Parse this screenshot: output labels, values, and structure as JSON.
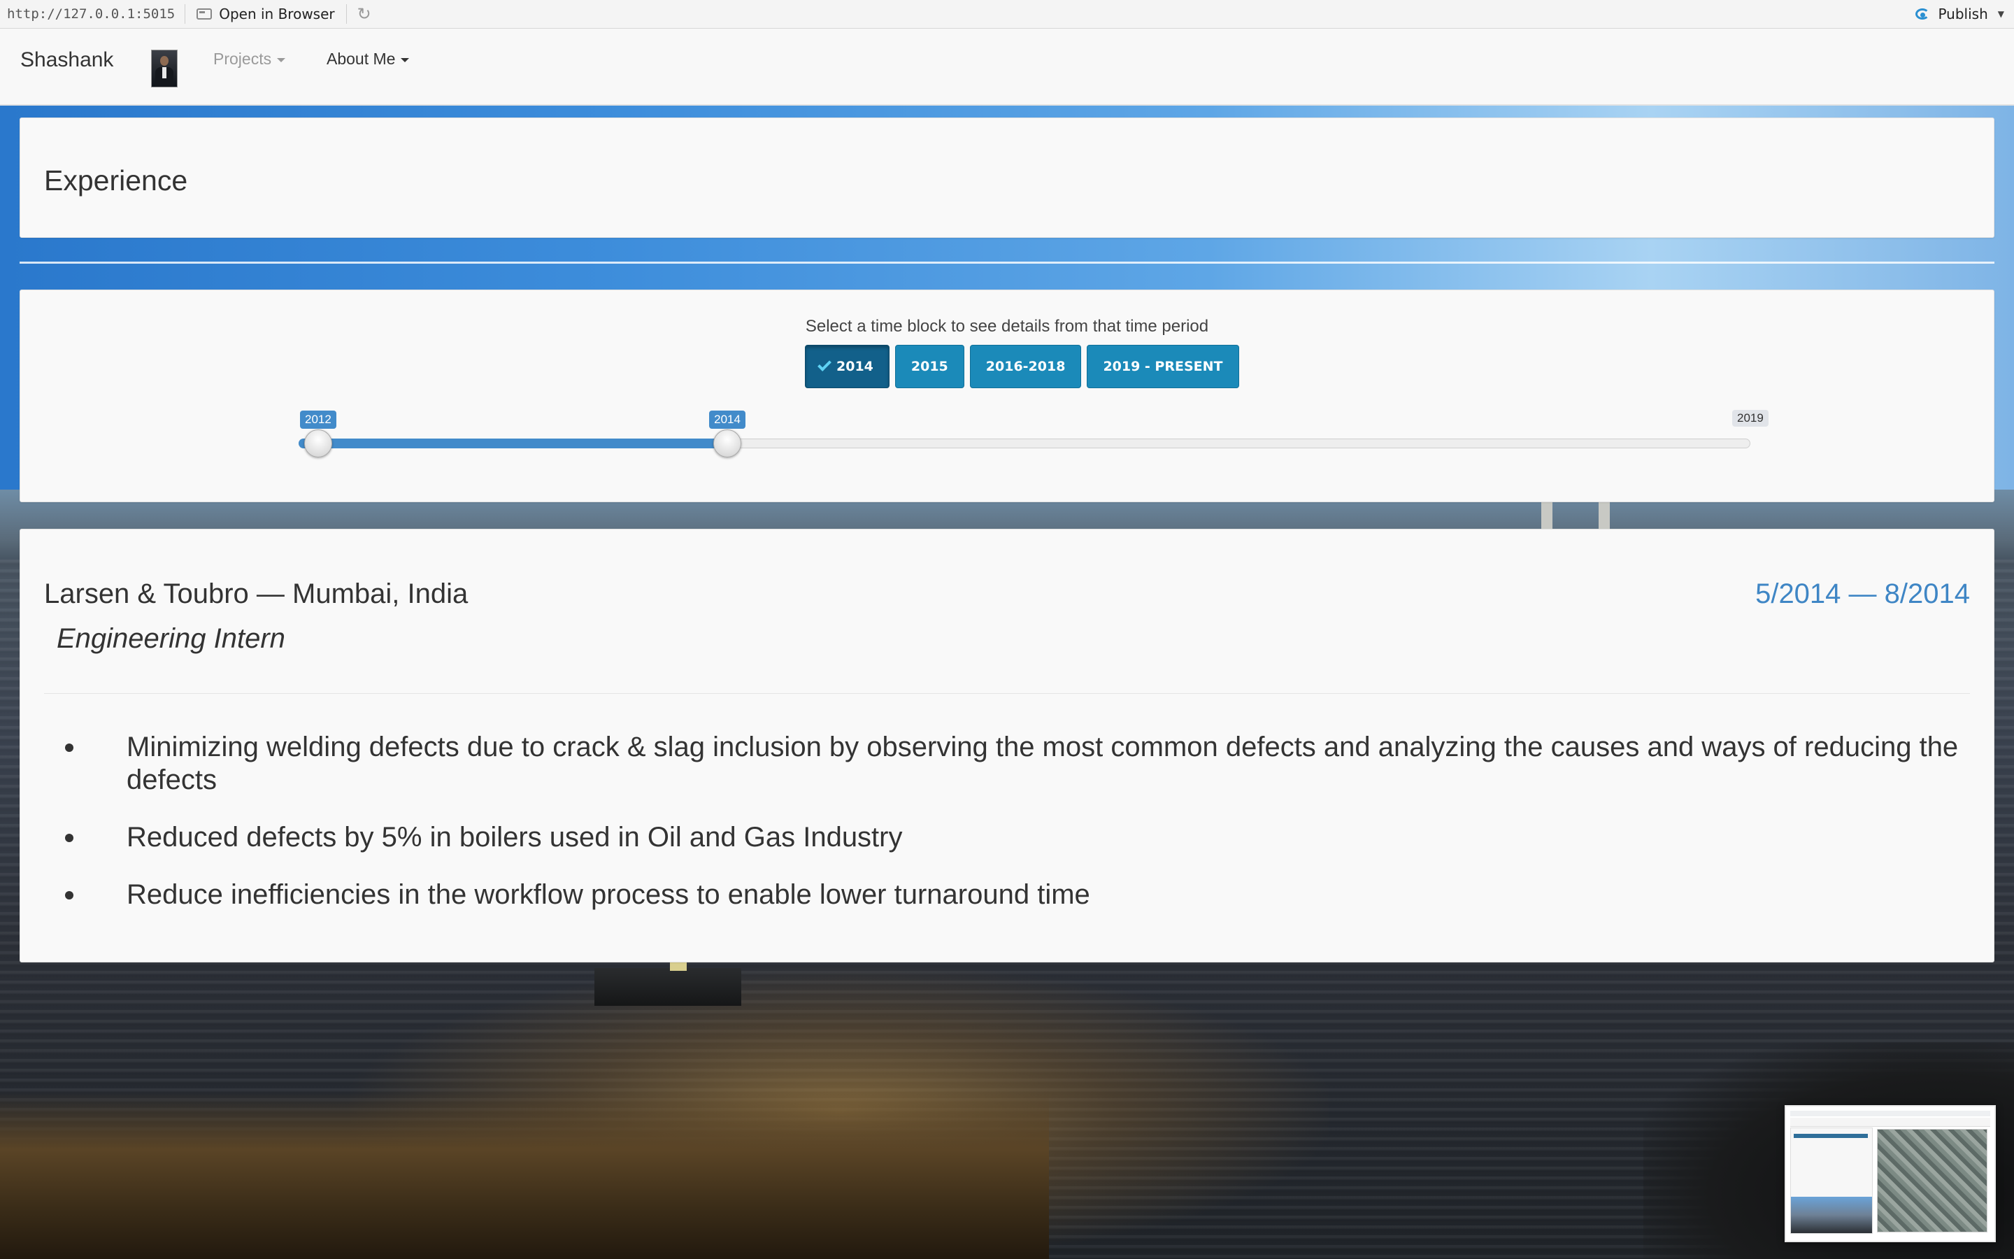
{
  "topbar": {
    "url": "http://127.0.0.1:5015",
    "open_in_browser": "Open in Browser",
    "publish": "Publish"
  },
  "navbar": {
    "brand": "Shashank",
    "menus": [
      {
        "label": "Projects",
        "state": "muted"
      },
      {
        "label": "About Me",
        "state": "normal"
      }
    ]
  },
  "title_panel": {
    "title": "Experience"
  },
  "controls": {
    "helper_text": "Select a time block to see details from that time period",
    "time_blocks": [
      {
        "label": "2014",
        "selected": true
      },
      {
        "label": "2015",
        "selected": false
      },
      {
        "label": "2016-2018",
        "selected": false
      },
      {
        "label": "2019 - PRESENT",
        "selected": false
      }
    ],
    "slider": {
      "min": 2012,
      "max": 2019,
      "from": 2014,
      "to": 2014,
      "from_label": "2012",
      "to_label": "2014",
      "max_label": "2019",
      "range_start": 2012,
      "range_end": 2014
    }
  },
  "detail": {
    "company": "Larsen & Toubro — Mumbai, India",
    "dates": "5/2014 — 8/2014",
    "role": "Engineering Intern",
    "bullets": [
      "Minimizing welding defects due to crack & slag inclusion by observing the most common defects and analyzing the causes and ways of reducing the defects",
      "Reduced defects by 5% in boilers used in Oil and Gas Industry",
      "Reduce inefficiencies in the workflow process to enable lower turnaround time"
    ]
  },
  "colors": {
    "accent": "#428bca",
    "button": "#1b8ab9",
    "button_active": "#12608a",
    "dates": "#3f86c5"
  },
  "icons": {
    "open_in_browser": "window-icon",
    "refresh": "refresh-icon",
    "publish": "publish-icon",
    "check": "check-icon"
  }
}
